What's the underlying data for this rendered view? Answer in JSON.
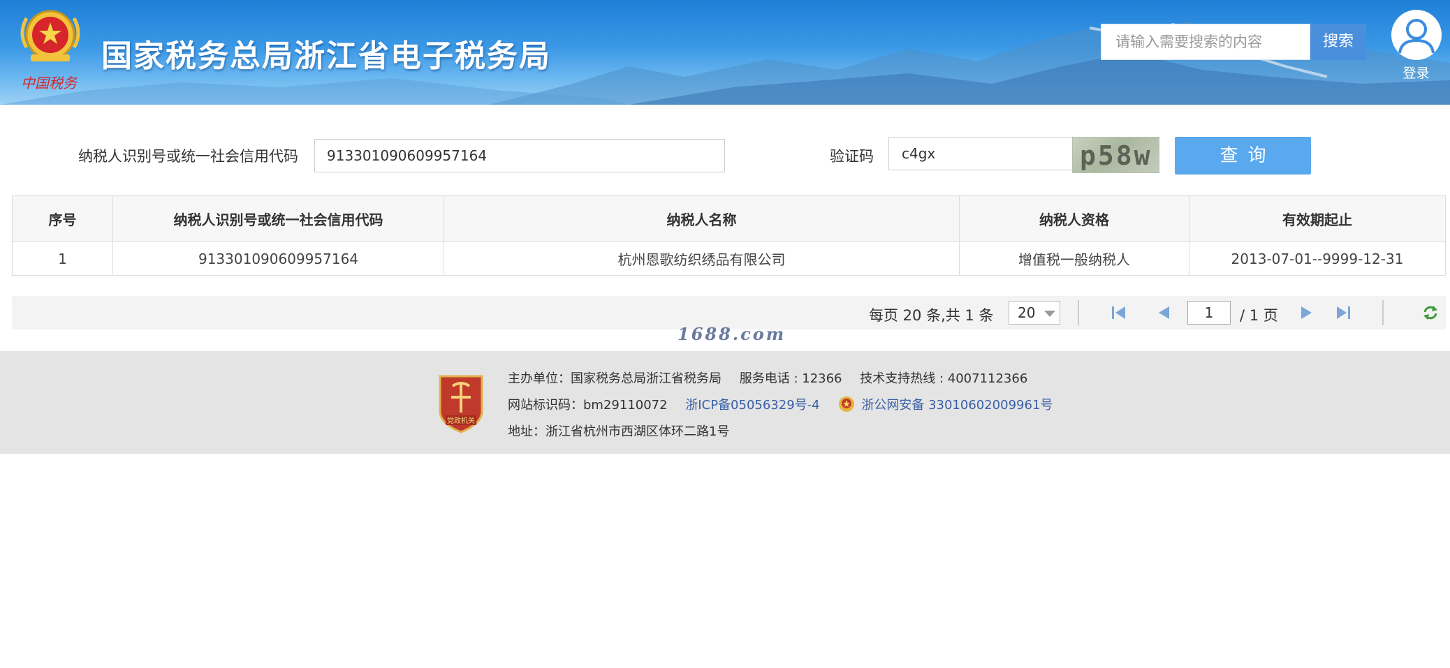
{
  "header": {
    "site_title": "国家税务总局浙江省电子税务局",
    "logo_text": "中国税务",
    "search_placeholder": "请输入需要搜索的内容",
    "search_button": "搜索",
    "login_label": "登录"
  },
  "form": {
    "taxpayer_id_label": "纳税人识别号或统一社会信用代码",
    "taxpayer_id_value": "913301090609957164",
    "captcha_label": "验证码",
    "captcha_value": "c4gx",
    "captcha_image_text": "p58w",
    "query_button": "查询"
  },
  "table": {
    "columns": [
      "序号",
      "纳税人识别号或统一社会信用代码",
      "纳税人名称",
      "纳税人资格",
      "有效期起止"
    ],
    "rows": [
      [
        "1",
        "913301090609957164",
        "杭州恩歌纺织绣品有限公司",
        "增值税一般纳税人",
        "2013-07-01--9999-12-31"
      ]
    ]
  },
  "pagination": {
    "info": "每页 20 条,共 1 条",
    "page_size": "20",
    "current_page": "1",
    "total_pages": "/ 1 页"
  },
  "watermark": "1688.com",
  "footer": {
    "line1": {
      "host": "主办单位：国家税务总局浙江省税务局",
      "service": "服务电话 : 12366",
      "support": "技术支持热线 : 4007112366"
    },
    "line2": {
      "site_code": "网站标识码：bm29110072",
      "icp": "浙ICP备05056329号-4",
      "police": "浙公网安备 33010602009961号"
    },
    "line3": {
      "address": "地址：浙江省杭州市西湖区体环二路1号"
    },
    "badge_text": "党政机关"
  },
  "colors": {
    "header_blue": "#2b88dc",
    "query_button": "#5aa9ee",
    "search_button": "#4a8fdc",
    "link": "#3a5fa8",
    "footer_bg": "#e4e4e4"
  },
  "icons": [
    "national-emblem-icon",
    "user-avatar-icon",
    "first-page-icon",
    "prev-page-icon",
    "next-page-icon",
    "last-page-icon",
    "refresh-icon",
    "party-gov-badge-icon",
    "police-emblem-icon"
  ]
}
